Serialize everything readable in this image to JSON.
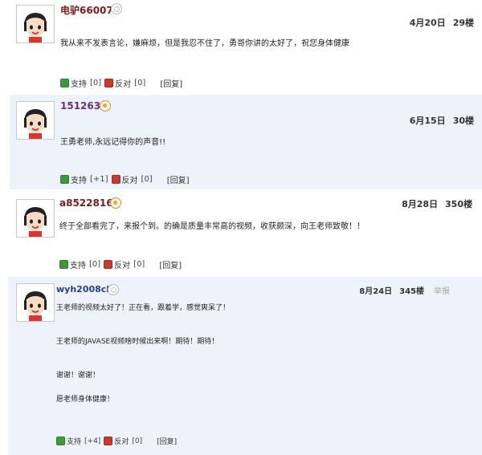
{
  "comments": [
    {
      "username": "电驴66007",
      "date": "4月20日",
      "floor": "29楼",
      "lines": [
        "我从来不发表言论，嫌麻烦，但是我忍不住了，勇哥你讲的太好了，祝您身体健康"
      ],
      "support_label": "支持",
      "support_count": "[0]",
      "oppose_label": "反对",
      "oppose_count": "[0]",
      "reply_label": "[回复]"
    },
    {
      "username": "151263",
      "date": "6月15日",
      "floor": "30楼",
      "lines": [
        "王勇老师,永远记得你的声音!!"
      ],
      "support_label": "支持",
      "support_count": "[+1]",
      "oppose_label": "反对",
      "oppose_count": "[0]",
      "reply_label": "[回复]"
    },
    {
      "username": "a8522816",
      "date": "8月28日",
      "floor": "350楼",
      "lines": [
        "终于全部看完了，来报个到。的确是质量丰常高的视频，收获颇深，向王老师致敬！！"
      ],
      "support_label": "支持",
      "support_count": "[0]",
      "oppose_label": "反对",
      "oppose_count": "[0]",
      "reply_label": "[回复]"
    },
    {
      "username": "wyh2008cb",
      "date": "8月24日",
      "floor": "345楼",
      "report_label": "举报",
      "lines": [
        "王老师的视频太好了！正在看，跟着学，感觉爽呆了！",
        "王老师的JAVASE视频啥时候出来啊！期待！期待！",
        "谢谢！谢谢！",
        "愿老师身体健康！"
      ],
      "support_label": "支持",
      "support_count": "[+4]",
      "oppose_label": "反对",
      "oppose_count": "[0]",
      "reply_label": "[回复]"
    }
  ],
  "colors": {
    "alt_background": "#eef2fb",
    "support_icon": "#3c9a3c",
    "oppose_icon": "#c9392e"
  }
}
